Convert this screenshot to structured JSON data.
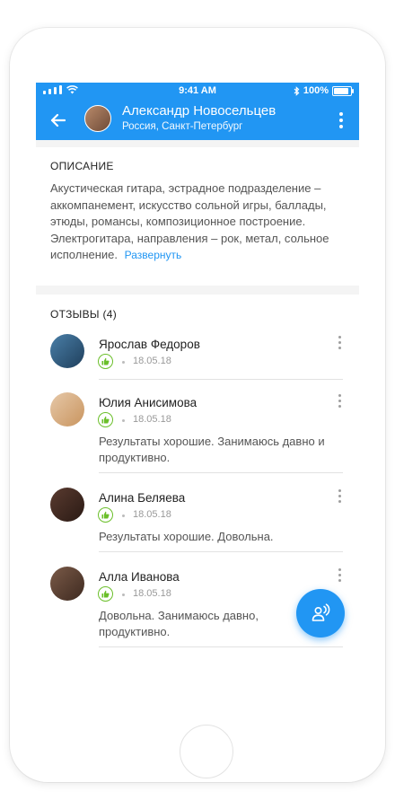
{
  "status_bar": {
    "time": "9:41 AM",
    "battery": "100%"
  },
  "header": {
    "name": "Александр Новосельцев",
    "location": "Россия, Санкт-Петербург"
  },
  "description": {
    "title": "ОПИСАНИЕ",
    "text": "Акустическая гитара, эстрадное подразделение – аккомпанемент, искусство сольной игры, баллады, этюды, романсы, композиционное построение. Электрогитара, направления – рок, метал, сольное исполнение.",
    "expand_label": "Развернуть"
  },
  "reviews": {
    "title": "ОТЗЫВЫ (4)",
    "items": [
      {
        "name": "Ярослав Федоров",
        "date": "18.05.18",
        "text": ""
      },
      {
        "name": "Юлия Анисимова",
        "date": "18.05.18",
        "text": "Результаты хорошие. Занимаюсь давно и продуктивно."
      },
      {
        "name": "Алина Беляева",
        "date": "18.05.18",
        "text": "Результаты хорошие. Довольна."
      },
      {
        "name": "Алла Иванова",
        "date": "18.05.18",
        "text": "Довольна. Занимаюсь давно, продуктивно."
      }
    ]
  },
  "colors": {
    "primary": "#2196f3",
    "like": "#6bbf2a",
    "background": "#f4f4f4"
  },
  "icons": [
    "wifi-icon",
    "bluetooth-icon",
    "battery-icon",
    "back-arrow-icon",
    "more-vert-icon",
    "thumb-up-icon",
    "contact-voice-icon"
  ]
}
